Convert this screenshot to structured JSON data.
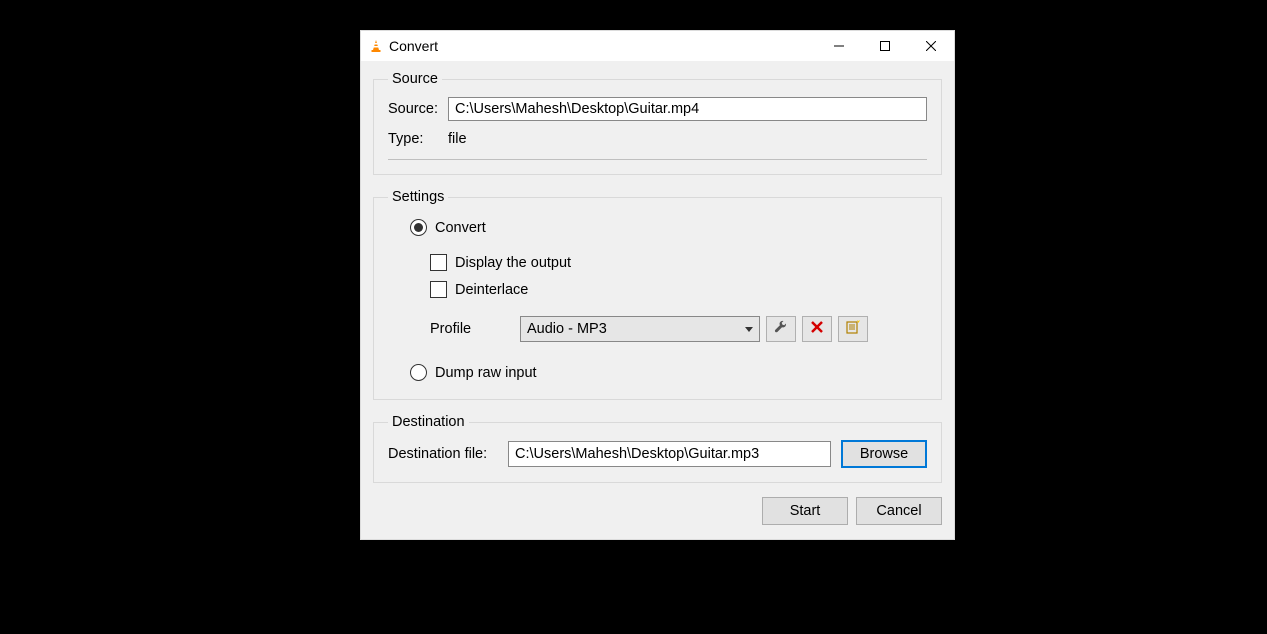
{
  "window": {
    "title": "Convert"
  },
  "source_group": {
    "legend": "Source",
    "source_label": "Source:",
    "source_value": "C:\\Users\\Mahesh\\Desktop\\Guitar.mp4",
    "type_label": "Type:",
    "type_value": "file"
  },
  "settings_group": {
    "legend": "Settings",
    "convert_radio_label": "Convert",
    "display_output_label": "Display the output",
    "deinterlace_label": "Deinterlace",
    "profile_label": "Profile",
    "profile_value": "Audio - MP3",
    "dump_raw_label": "Dump raw input"
  },
  "destination_group": {
    "legend": "Destination",
    "dest_label": "Destination file:",
    "dest_value": "C:\\Users\\Mahesh\\Desktop\\Guitar.mp3",
    "browse_label": "Browse"
  },
  "actions": {
    "start_label": "Start",
    "cancel_label": "Cancel"
  }
}
